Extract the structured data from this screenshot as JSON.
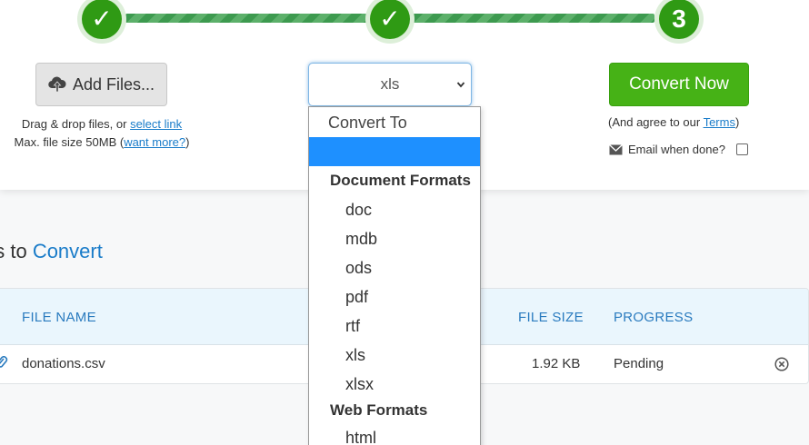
{
  "steps": [
    {
      "id": "step-1",
      "label": "✓"
    },
    {
      "id": "step-2",
      "label": "✓"
    },
    {
      "id": "step-3",
      "label": "3"
    }
  ],
  "add_files": {
    "button_label": "Add Files...",
    "drag_prefix": "Drag & drop files, or ",
    "select_link": "select link",
    "max_prefix": "Max. file size 50MB (",
    "want_more": "want more?",
    "max_suffix": ")"
  },
  "format_select": {
    "value": "xls",
    "placeholder_option": "Convert To",
    "groups": [
      {
        "label": "Document Formats",
        "options": [
          "doc",
          "mdb",
          "ods",
          "pdf",
          "rtf",
          "xls",
          "xlsx"
        ]
      },
      {
        "label": "Web Formats",
        "options": [
          "html"
        ]
      }
    ]
  },
  "convert": {
    "button_label": "Convert Now",
    "agree_prefix": "(And agree to our ",
    "terms_link": "Terms",
    "agree_suffix": ")",
    "email_label": "Email when done?"
  },
  "files_section": {
    "title_prefix": "es to ",
    "title_highlight": "Convert",
    "columns": {
      "file_name": "FILE NAME",
      "file_size": "FILE SIZE",
      "progress": "PROGRESS"
    },
    "rows": [
      {
        "file_name": "donations.csv",
        "file_size": "1.92 KB",
        "progress": "Pending"
      }
    ]
  },
  "colors": {
    "accent_green": "#46b216",
    "step_green": "#2f9a14",
    "link_blue": "#1a7cc9",
    "selected_option": "#1e90ff"
  }
}
